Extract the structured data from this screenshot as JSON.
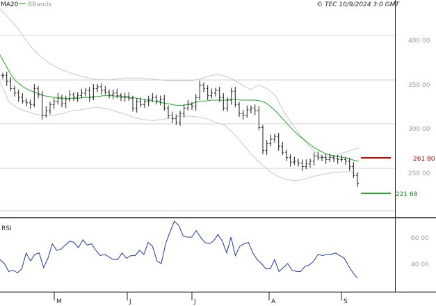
{
  "header": {
    "ma_label": "MA20",
    "bb_label": "BBands",
    "copyright": "© TEC 10/9/2024 3:0 GMT"
  },
  "colors": {
    "price": "#1a1a1a",
    "ma": "#22aa22",
    "bbands": "#c8c8c8",
    "rsi": "#2233aa",
    "grid": "#d0d0d0",
    "resistance": "#cc0000",
    "support": "#22aa22"
  },
  "chart_data": [
    {
      "type": "line",
      "title": "",
      "x_months": [
        "M",
        "J",
        "J",
        "A",
        "S"
      ],
      "y_ticks": [
        "400 00",
        "350 00",
        "300 00",
        "250 00"
      ],
      "ylim": [
        190,
        438
      ],
      "series": [
        {
          "name": "price",
          "values": [
            355,
            348,
            340,
            335,
            330,
            326,
            324,
            322,
            340,
            333,
            310,
            315,
            322,
            325,
            330,
            323,
            328,
            333,
            330,
            332,
            335,
            338,
            330,
            340,
            342,
            338,
            336,
            333,
            335,
            332,
            330,
            331,
            329,
            318,
            325,
            322,
            325,
            328,
            330,
            326,
            328,
            318,
            310,
            306,
            302,
            312,
            318,
            322,
            320,
            330,
            344,
            340,
            332,
            335,
            338,
            330,
            318,
            327,
            337,
            322,
            312,
            310,
            316,
            318,
            315,
            296,
            270,
            278,
            283,
            286,
            275,
            268,
            262,
            257,
            258,
            256,
            252,
            255,
            258,
            264,
            262,
            262,
            260,
            262,
            261,
            260,
            260,
            258,
            252,
            242,
            233
          ]
        },
        {
          "name": "MA20",
          "values": [
            378,
            368,
            358,
            350,
            345,
            341,
            338,
            336,
            334,
            332,
            331,
            330,
            329,
            329,
            329,
            329,
            329,
            330,
            330,
            331,
            331,
            332,
            332,
            332,
            331,
            331,
            330,
            330,
            329,
            328,
            327,
            326,
            325,
            324,
            323,
            322,
            321,
            321,
            322,
            323,
            325,
            326,
            326,
            327,
            327,
            327,
            327,
            328,
            328,
            327,
            327,
            327,
            327,
            326,
            324,
            320,
            315,
            309,
            303,
            297,
            291,
            286,
            282,
            277,
            273,
            270,
            267,
            265,
            264,
            263,
            262,
            261,
            259,
            258
          ]
        },
        {
          "name": "BBands upper",
          "values": [
            430,
            420,
            410,
            396,
            384,
            375,
            368,
            363,
            359,
            356,
            353,
            351,
            350,
            350,
            351,
            352,
            352,
            352,
            351,
            350,
            349,
            349,
            349,
            349,
            351,
            354,
            356,
            354,
            350,
            344,
            339,
            344,
            340,
            332,
            314,
            300,
            287,
            275,
            266,
            262,
            263,
            267,
            270,
            273
          ]
        },
        {
          "name": "BBands lower",
          "values": [
            348,
            325,
            318,
            314,
            311,
            309,
            310,
            312,
            315,
            316,
            318,
            319,
            317,
            314,
            311,
            307,
            305,
            304,
            305,
            307,
            309,
            309,
            308,
            306,
            302,
            299,
            290,
            278,
            266,
            256,
            247,
            241,
            237,
            236,
            238,
            241,
            243,
            245,
            246,
            246,
            244
          ]
        },
        {
          "name": "RSI",
          "values": [
            43,
            40,
            34,
            35,
            33,
            36,
            48,
            42,
            47,
            48,
            37,
            44,
            55,
            50,
            51,
            54,
            57,
            56,
            52,
            58,
            54,
            55,
            50,
            46,
            47,
            45,
            43,
            43,
            48,
            44,
            46,
            46,
            50,
            47,
            56,
            53,
            42,
            40,
            55,
            64,
            72,
            69,
            61,
            60,
            60,
            65,
            60,
            56,
            55,
            57,
            62,
            57,
            48,
            60,
            46,
            53,
            55,
            56,
            48,
            43,
            40,
            36,
            36,
            43,
            34,
            37,
            40,
            35,
            34,
            34,
            38,
            39,
            42,
            47,
            46,
            47,
            47,
            48,
            46,
            44,
            38,
            33,
            29
          ]
        }
      ],
      "levels": [
        {
          "label": "261 80",
          "value": 261.8
        },
        {
          "label": "221 68",
          "value": 221.68
        }
      ]
    },
    {
      "type": "line",
      "title": "RSI",
      "y_ticks": [
        "60 00",
        "40 00"
      ],
      "ylim": [
        30,
        80
      ]
    }
  ]
}
